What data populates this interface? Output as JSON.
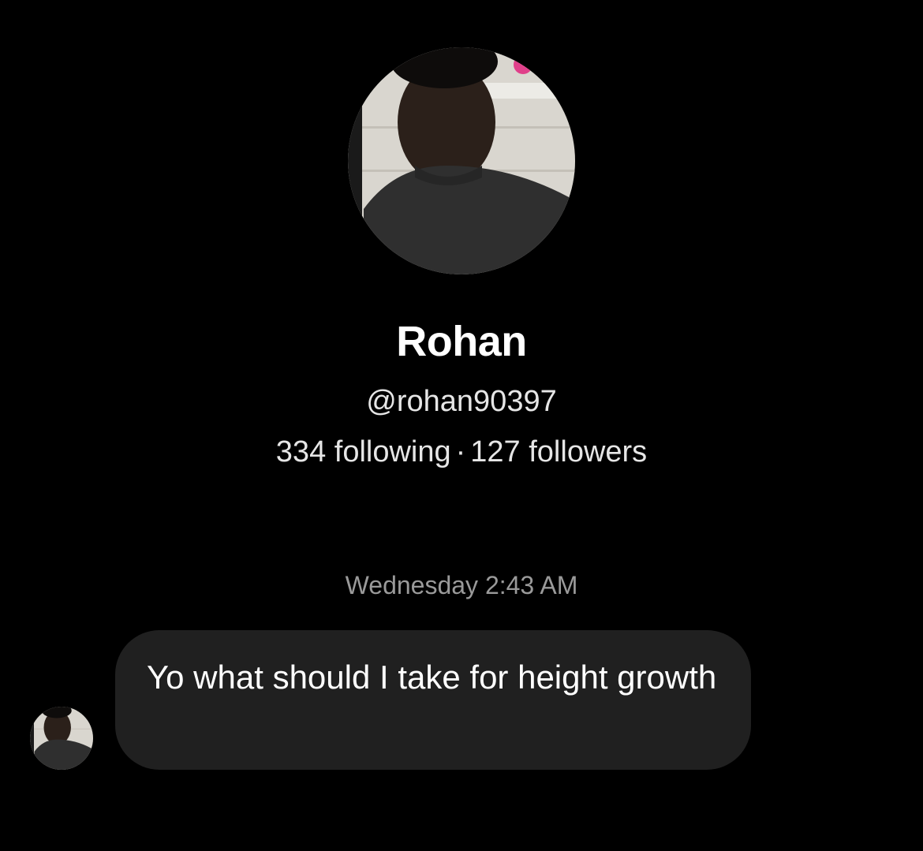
{
  "profile": {
    "name": "Rohan",
    "handle": "@rohan90397",
    "following": "334 following",
    "separator": "·",
    "followers": "127 followers"
  },
  "conversation": {
    "timestamp": "Wednesday 2:43 AM",
    "messages": [
      {
        "sender": "Rohan",
        "text": "Yo what should I take for height growth"
      }
    ]
  },
  "colors": {
    "background": "#000000",
    "bubble": "#202020",
    "timestamp": "#9a9a9a"
  }
}
